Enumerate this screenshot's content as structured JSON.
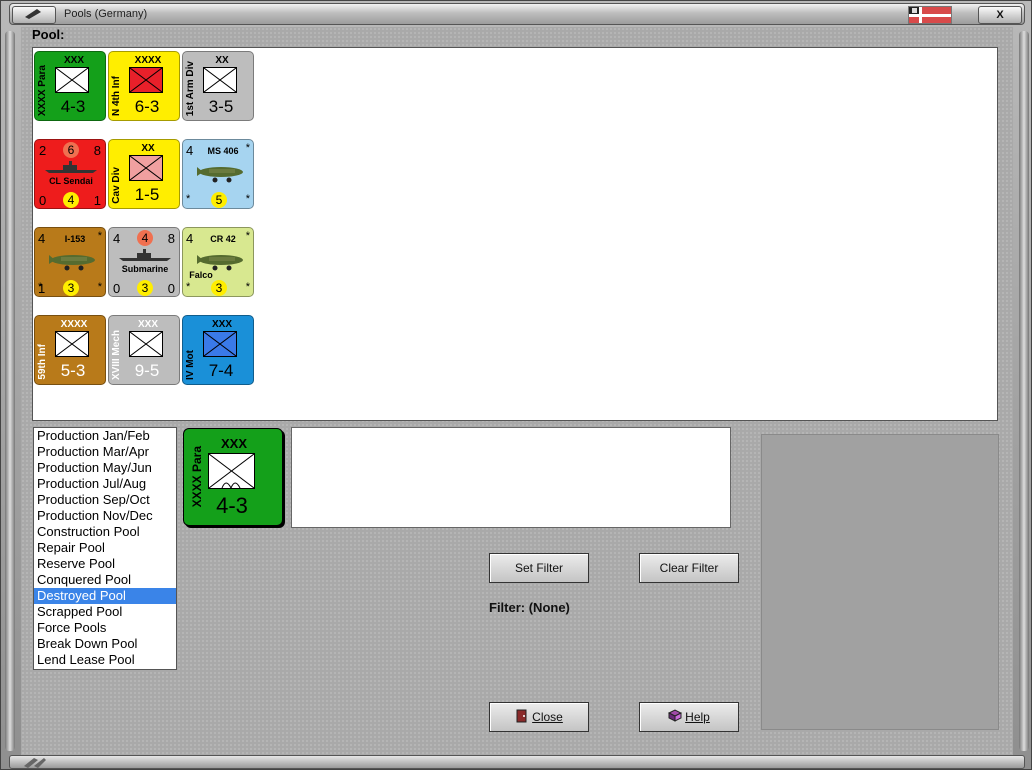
{
  "window": {
    "title": "Pools (Germany)",
    "close_glyph": "X"
  },
  "pool": {
    "label": "Pool:",
    "counters": [
      {
        "side": "XXXX Para",
        "size": "XXX",
        "strength": "4-3",
        "bg": "#14a01a",
        "fg": "#000",
        "box_bg": "#fff"
      },
      {
        "side": "N 4th Inf",
        "size": "XXXX",
        "strength": "6-3",
        "bg": "#ffee00",
        "fg": "#000",
        "box_bg": "#e8202a"
      },
      {
        "side": "1st Arm Div",
        "size": "XX",
        "strength": "3-5",
        "bg": "#bdbdbd",
        "fg": "#000",
        "box_bg": "#fff"
      },
      {
        "name": "CL Sendai",
        "top": [
          "2",
          "6",
          "8"
        ],
        "bottom": [
          "0",
          "4",
          "1"
        ],
        "bg": "#ee1c1c"
      },
      {
        "side": "Cav Div",
        "size": "XX",
        "strength": "1-5",
        "bg": "#ffee00",
        "fg": "#000",
        "box_bg": "#f0a0a0"
      },
      {
        "name": "MS 406",
        "top_left": "4",
        "star": "*",
        "bottom_dot": "5",
        "bg": "#a6d4f0"
      },
      {
        "name": "I-153",
        "top_left": "4",
        "star": "*",
        "bottom_left": "1",
        "bottom_dot": "3",
        "bg": "#b87a1a"
      },
      {
        "name": "Submarine",
        "top": [
          "4",
          "4",
          "8"
        ],
        "bottom": [
          "0",
          "3",
          "0"
        ],
        "bg": "#bdbdbd"
      },
      {
        "name": "CR 42",
        "sub": "Falco",
        "top_left": "4",
        "star": "*",
        "bottom_dot": "3",
        "bg": "#d8e890"
      },
      {
        "side": "59th Inf",
        "size": "XXXX",
        "strength": "5-3",
        "bg": "#b87a1a",
        "fg": "#fff",
        "box_bg": "#fff"
      },
      {
        "side": "XVIII Mech",
        "size": "XXX",
        "strength": "9-5",
        "bg": "#bdbdbd",
        "fg": "#fff",
        "box_bg": "#fff"
      },
      {
        "side": "IV Mot",
        "size": "XXX",
        "strength": "7-4",
        "bg": "#1a90d8",
        "fg": "#000",
        "box_bg": "#3a7ae8"
      }
    ]
  },
  "pool_list": {
    "items": [
      "Production Jan/Feb",
      "Production Mar/Apr",
      "Production May/Jun",
      "Production Jul/Aug",
      "Production Sep/Oct",
      "Production Nov/Dec",
      "Construction Pool",
      "Repair Pool",
      "Reserve Pool",
      "Conquered Pool",
      "Destroyed Pool",
      "Scrapped Pool",
      "Force Pools",
      "Break Down Pool",
      "Lend Lease Pool"
    ],
    "selected_index": 10
  },
  "selected_counter": {
    "side": "XXXX Para",
    "size": "XXX",
    "strength": "4-3",
    "bg": "#14a01a"
  },
  "buttons": {
    "set_filter": "Set Filter",
    "clear_filter": "Clear Filter",
    "close": "Close",
    "help": "Help"
  },
  "filter": {
    "label": "Filter: (None)"
  }
}
